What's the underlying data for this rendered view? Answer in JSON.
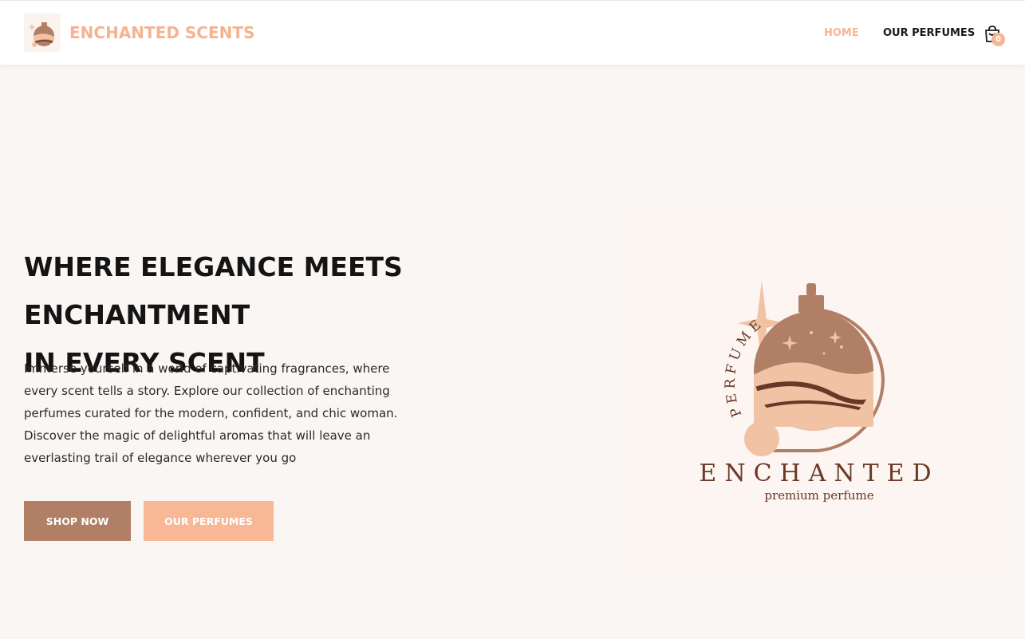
{
  "header": {
    "brand_name": "ENCHANTED SCENTS",
    "nav": {
      "home": "HOME",
      "perfumes": "OUR PERFUMES"
    },
    "cart_count": "0",
    "cart_icon": "cart-icon"
  },
  "hero": {
    "title_line1": "WHERE ELEGANCE MEETS ENCHANTMENT",
    "title_line2": "IN EVERY SCENT",
    "description": "Immerse yourself in a world of captivating fragrances, where every scent tells a story. Explore our collection of enchanting perfumes curated for the modern, confident, and chic woman. Discover the magic of delightful aromas that will leave an everlasting trail of elegance wherever you go",
    "buttons": {
      "shop": "SHOP NOW",
      "perfumes": "OUR PERFUMES"
    }
  },
  "logo": {
    "arc_text": "PERFUME",
    "wordmark": "ENCHANTED",
    "tagline": "premium perfume"
  },
  "colors": {
    "accent": "#f6b595",
    "brown": "#b17f66",
    "dark_brown": "#6a3826",
    "background": "#faf6f4"
  }
}
